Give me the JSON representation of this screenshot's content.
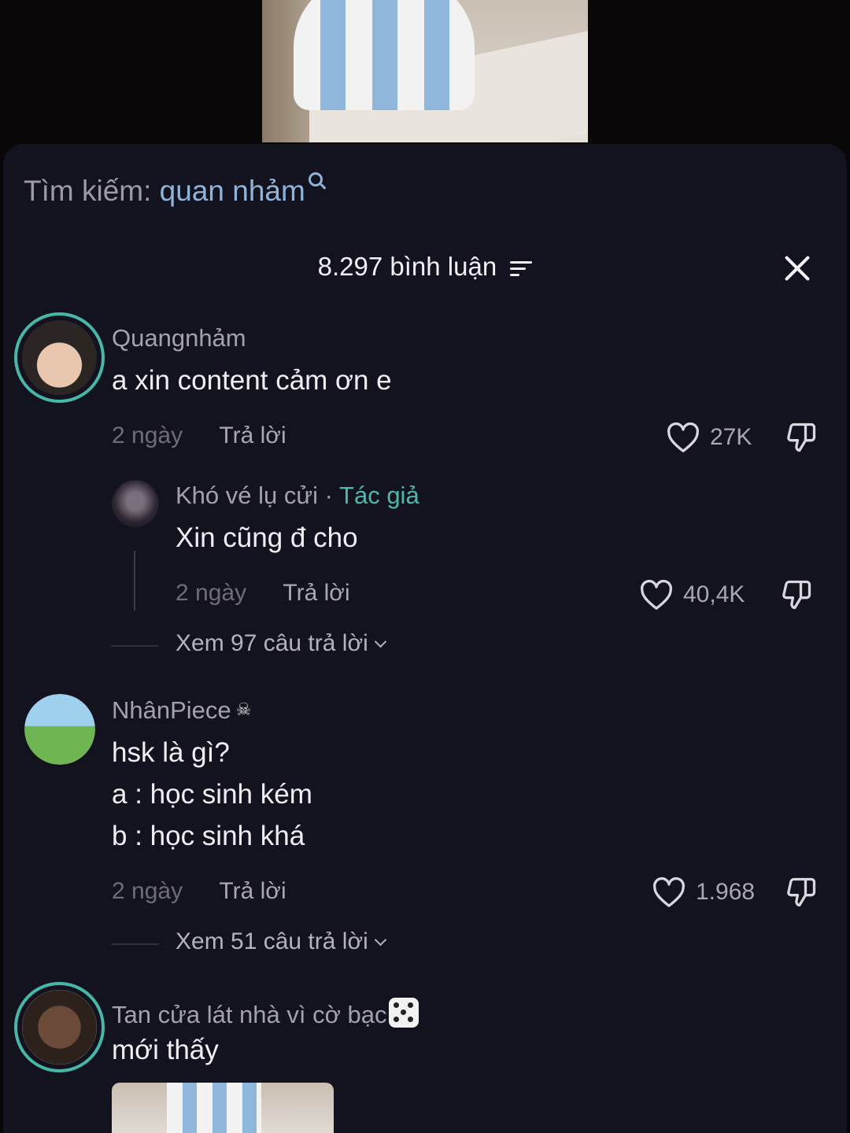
{
  "search": {
    "label": "Tìm kiếm:",
    "query": "quan nhảm"
  },
  "header": {
    "count_text": "8.297 bình luận"
  },
  "comments": [
    {
      "username": "Quangnhảm",
      "lines": [
        "a xin content cảm ơn e"
      ],
      "date": "2 ngày",
      "reply_label": "Trả lời",
      "likes": "27K",
      "reply": {
        "username": "Khó vé lụ cửi",
        "author_sep": "·",
        "author_badge": "Tác giả",
        "text": "Xin cũng đ cho",
        "date": "2 ngày",
        "reply_label": "Trả lời",
        "likes": "40,4K"
      },
      "view_replies": "Xem 97 câu trả lời"
    },
    {
      "username": "NhânPiece",
      "lines": [
        "hsk là gì?",
        "a : học sinh kém",
        "b : học sinh khá"
      ],
      "date": "2 ngày",
      "reply_label": "Trả lời",
      "likes": "1.968",
      "view_replies": "Xem 51 câu trả lời"
    },
    {
      "username": "Tan cửa lát nhà vì cờ bạc",
      "lines": [
        "mới thấy"
      ]
    }
  ],
  "colors": {
    "accent": "#4fb8ad",
    "query": "#8fb4d8",
    "sheet": "#13131f"
  },
  "icons": [
    "search-icon",
    "filter-icon",
    "close-icon",
    "heart-icon",
    "dislike-icon",
    "chevron-down-icon",
    "dice-icon",
    "skull-icon"
  ]
}
